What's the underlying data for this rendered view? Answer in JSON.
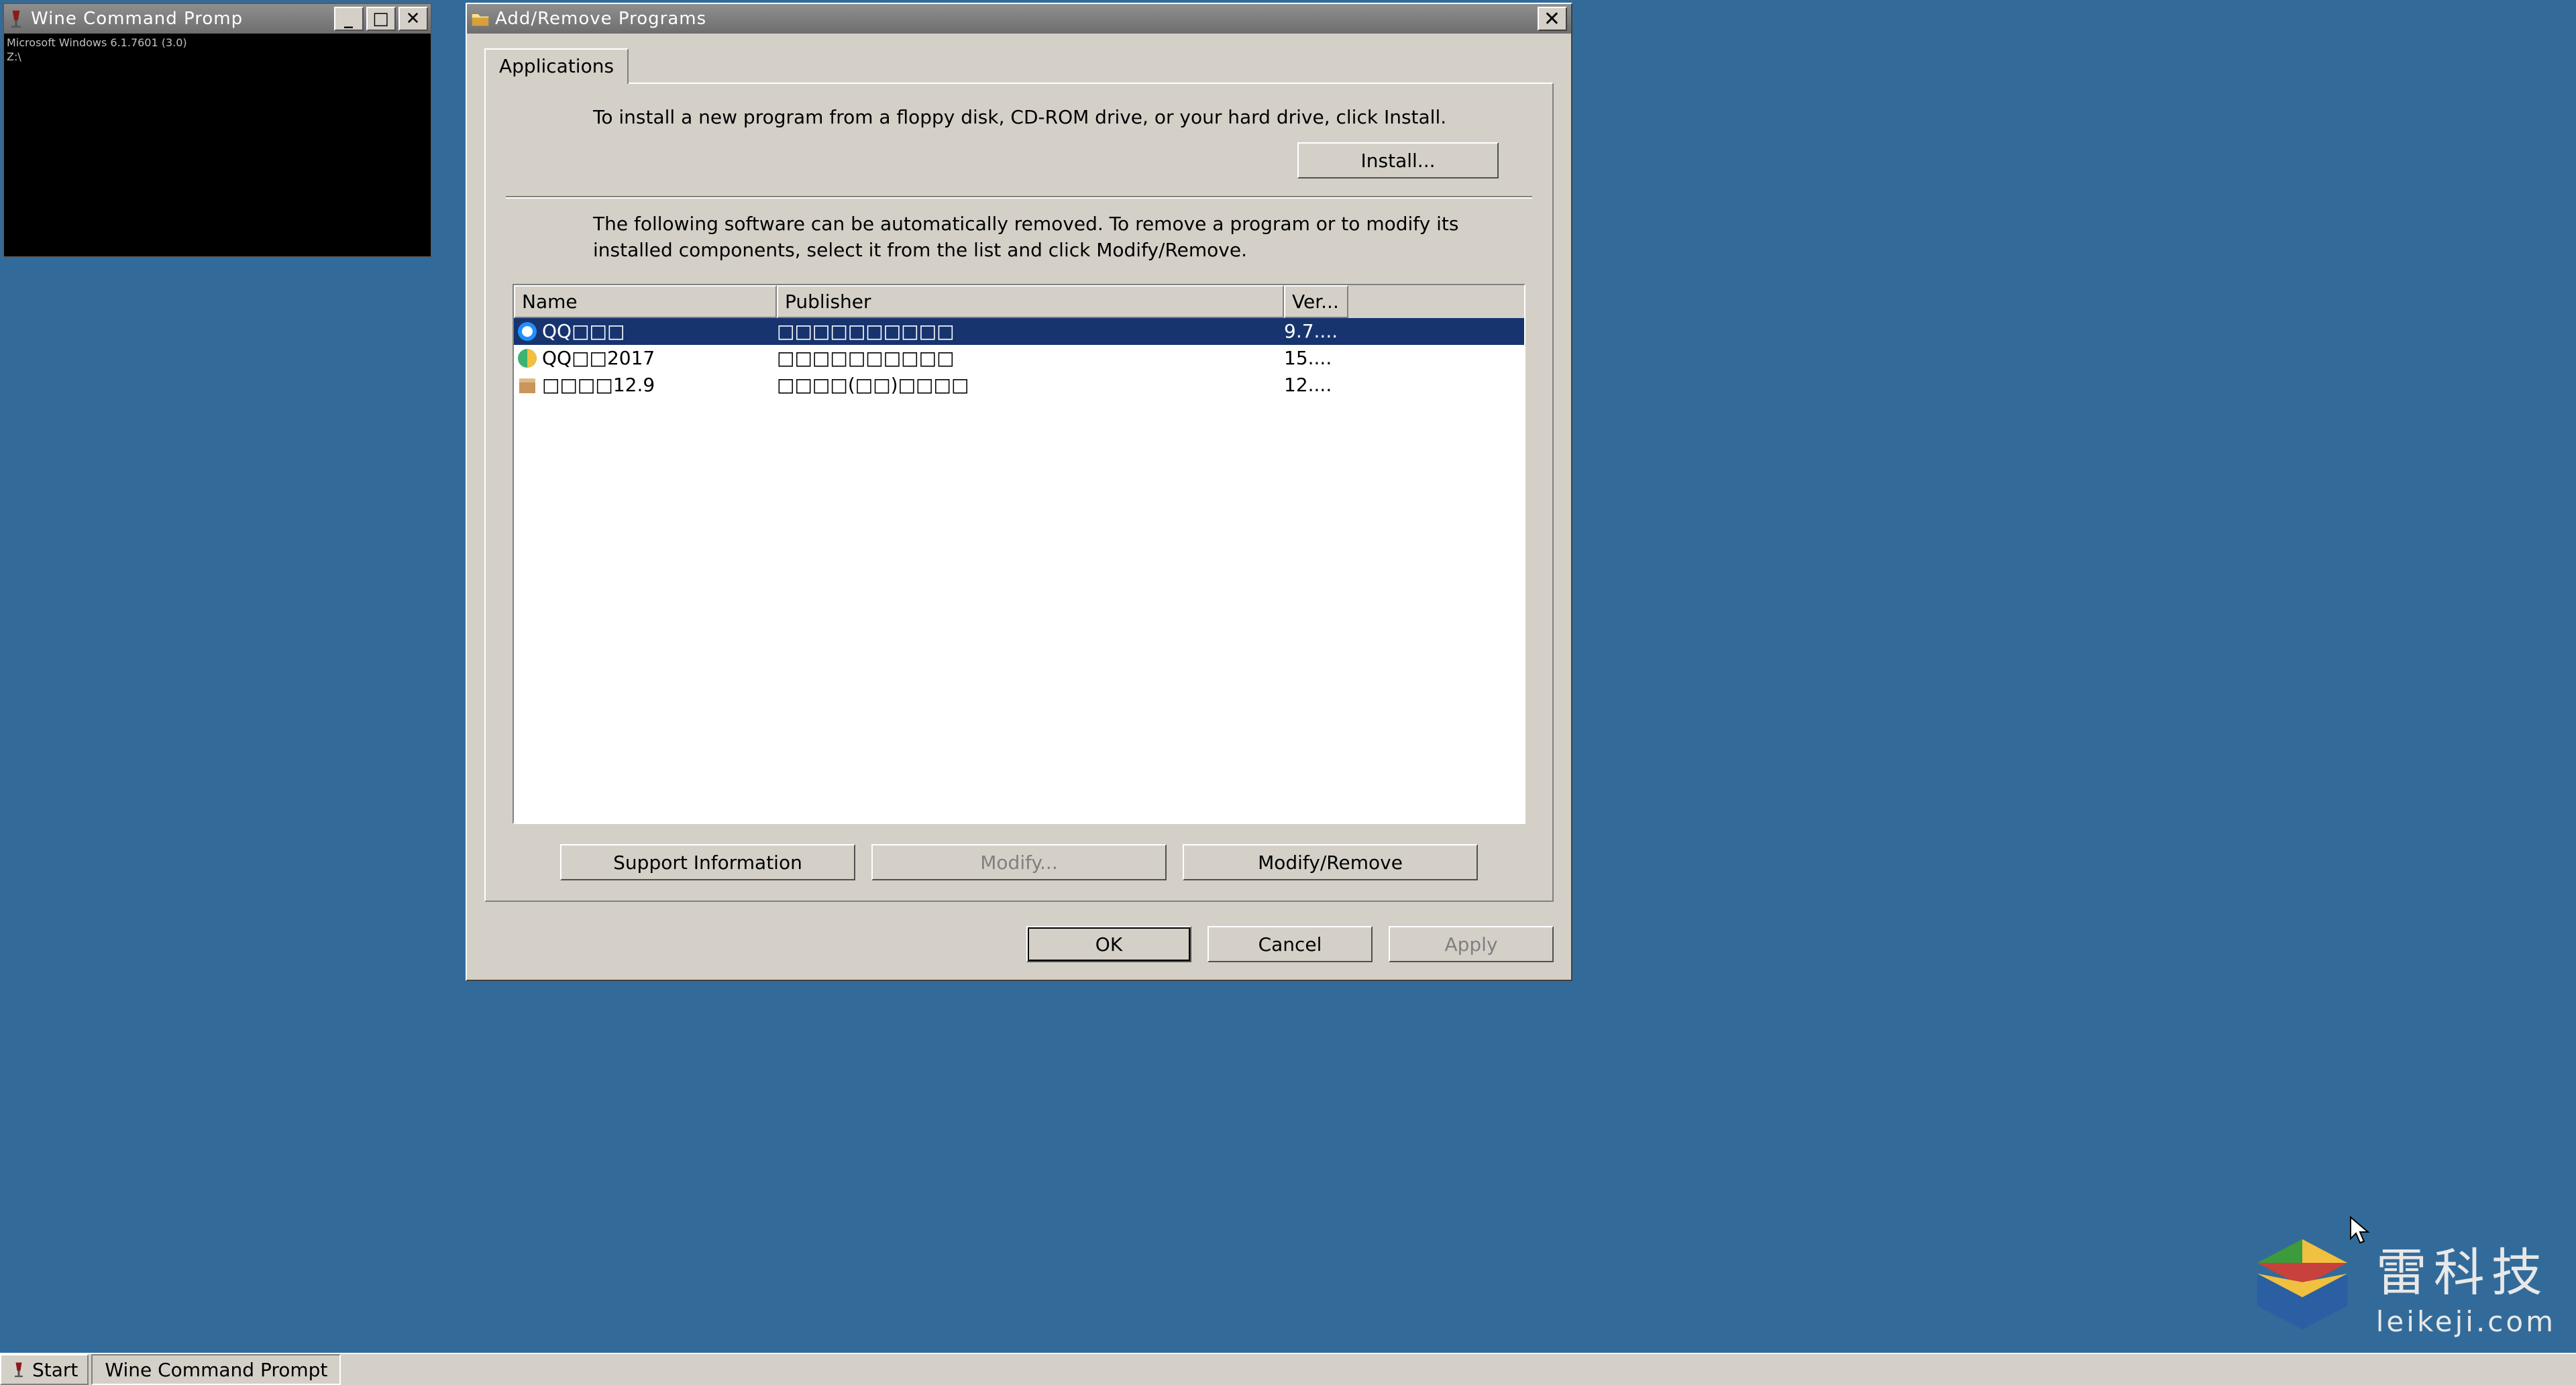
{
  "console": {
    "title": "Wine Command Promp",
    "body_line1": "Microsoft Windows 6.1.7601 (3.0)",
    "body_line2": "Z:\\"
  },
  "dialog": {
    "title": "Add/Remove Programs",
    "tab_label": "Applications",
    "install_text": "To install a new program from a floppy disk, CD-ROM drive, or your hard drive, click Install.",
    "install_button": "Install...",
    "remove_text": "The following software can be automatically removed. To remove a program or to modify its installed components, select it from the list and click Modify/Remove.",
    "columns": {
      "name": "Name",
      "publisher": "Publisher",
      "version": "Ver..."
    },
    "rows": [
      {
        "name": "QQ□□□",
        "publisher": "□□□□□□□□□□",
        "version": "9.7....",
        "icon": "qq-blue",
        "selected": true
      },
      {
        "name": "QQ□□2017",
        "publisher": "□□□□□□□□□□",
        "version": "15....",
        "icon": "qq-music",
        "selected": false
      },
      {
        "name": "□□□□12.9",
        "publisher": "□□□□(□□)□□□□",
        "version": "12....",
        "icon": "box",
        "selected": false
      }
    ],
    "support_button": "Support Information",
    "modify_button": "Modify...",
    "modify_remove_button": "Modify/Remove",
    "ok_button": "OK",
    "cancel_button": "Cancel",
    "apply_button": "Apply"
  },
  "taskbar": {
    "start": "Start",
    "task1": "Wine Command Prompt"
  },
  "watermark": {
    "big": "雷科技",
    "small": "leikeji.com"
  }
}
